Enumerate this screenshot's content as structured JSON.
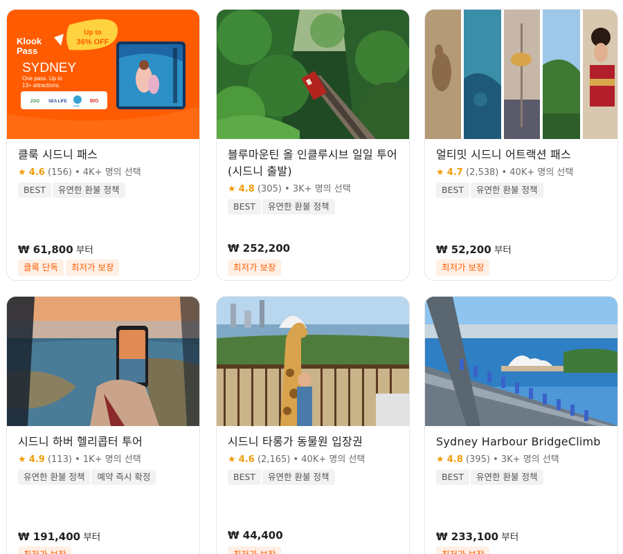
{
  "cards": [
    {
      "title": "클룩 시드니 패스",
      "star": "★",
      "score": "4.6",
      "count": "(156)",
      "booked": " • 4K+ 명의 선택",
      "tags": [
        "BEST",
        "유연한 환불 정책"
      ],
      "price": "₩ 61,800",
      "price_suffix": " 부터",
      "badges": [
        "클룩 단독",
        "최저가 보장"
      ],
      "image": {
        "brand": "Klook",
        "brand2": "Pass",
        "promo1": "Up to",
        "promo2": "36% OFF",
        "city": "SYDNEY",
        "tagline1": "One pass. Up to",
        "tagline2": "13+ attractions.",
        "logos": [
          "ZOO",
          "SEA LIFE",
          "wild",
          "BIG"
        ]
      }
    },
    {
      "title": "블루마운틴 올 인클루시브 일일 투어 (시드니 출발)",
      "star": "★",
      "score": "4.8",
      "count": "(305)",
      "booked": " • 3K+ 명의 선택",
      "tags": [
        "BEST",
        "유연한 환불 정책"
      ],
      "price": "₩ 252,200",
      "price_suffix": "",
      "badges": [
        "최저가 보장"
      ]
    },
    {
      "title": "얼티밋 시드니 어트랙션 패스",
      "star": "★",
      "score": "4.7",
      "count": "(2,538)",
      "booked": " • 40K+ 명의 선택",
      "tags": [
        "BEST",
        "유연한 환불 정책"
      ],
      "price": "₩ 52,200",
      "price_suffix": " 부터",
      "badges": [
        "최저가 보장"
      ]
    },
    {
      "title": "시드니 하버 헬리콥터 투어",
      "star": "★",
      "score": "4.9",
      "count": "(113)",
      "booked": " • 1K+ 명의 선택",
      "tags": [
        "유연한 환불 정책",
        "예약 즉시 확정"
      ],
      "price": "₩ 191,400",
      "price_suffix": " 부터",
      "badges": [
        "최저가 보장"
      ]
    },
    {
      "title": "시드니 타롱가 동물원 입장권",
      "star": "★",
      "score": "4.6",
      "count": "(2,165)",
      "booked": " • 40K+ 명의 선택",
      "tags": [
        "BEST",
        "유연한 환불 정책"
      ],
      "price": "₩ 44,400",
      "price_suffix": "",
      "badges": [
        "최저가 보장"
      ]
    },
    {
      "title": "Sydney Harbour BridgeClimb",
      "star": "★",
      "score": "4.8",
      "count": "(395)",
      "booked": " • 3K+ 명의 선택",
      "tags": [
        "BEST",
        "유연한 환불 정책"
      ],
      "price": "₩ 233,100",
      "price_suffix": " 부터",
      "badges": [
        "최저가 보장"
      ]
    }
  ],
  "colors": {
    "accent": "#ff5b00",
    "star": "#f09b0a",
    "badge_bg": "#fff0e6",
    "tag_bg": "#f2f2f2"
  }
}
